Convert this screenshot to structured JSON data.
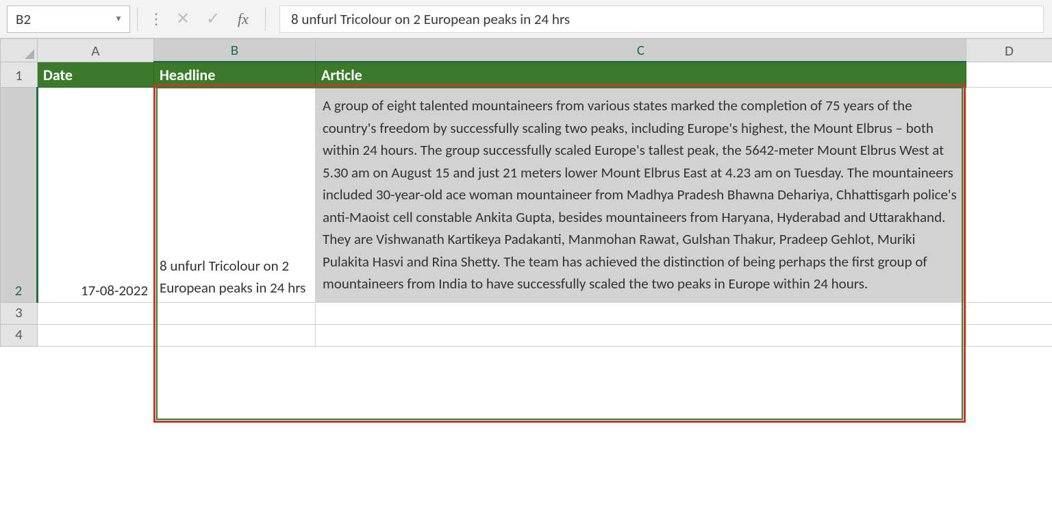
{
  "formula_bar": {
    "name_box": "B2",
    "fx_label": "fx",
    "formula_value": "8 unfurl Tricolour on 2 European peaks in 24 hrs"
  },
  "columns": {
    "A": "A",
    "B": "B",
    "C": "C",
    "D": "D"
  },
  "row_numbers": {
    "r1": "1",
    "r2": "2",
    "r3": "3",
    "r4": "4"
  },
  "table_header": {
    "date": "Date",
    "headline": "Headline",
    "article": "Article"
  },
  "rows": [
    {
      "date": "17-08-2022",
      "headline": "8 unfurl Tricolour on 2 European peaks in 24 hrs",
      "article": "A group of eight talented mountaineers from various states marked the completion of 75 years of the country's freedom by successfully scaling two peaks, including Europe's highest, the Mount Elbrus – both within 24 hours. The group successfully scaled Europe's tallest peak, the 5642-meter Mount Elbrus West at 5.30 am on August 15 and just 21 meters lower Mount Elbrus East at 4.23 am on Tuesday. The mountaineers included 30-year-old ace woman mountaineer from Madhya Pradesh Bhawna Dehariya, Chhattisgarh police's anti-Maoist cell constable Ankita Gupta, besides mountaineers from Haryana, Hyderabad and Uttarakhand. They are Vishwanath Kartikeya Padakanti, Manmohan Rawat, Gulshan Thakur, Pradeep Gehlot, Muriki Pulakita Hasvi and Rina Shetty. The team has achieved the distinction of being perhaps the first group of mountaineers from India to have successfully scaled the two peaks in Europe within 24 hours."
    }
  ]
}
